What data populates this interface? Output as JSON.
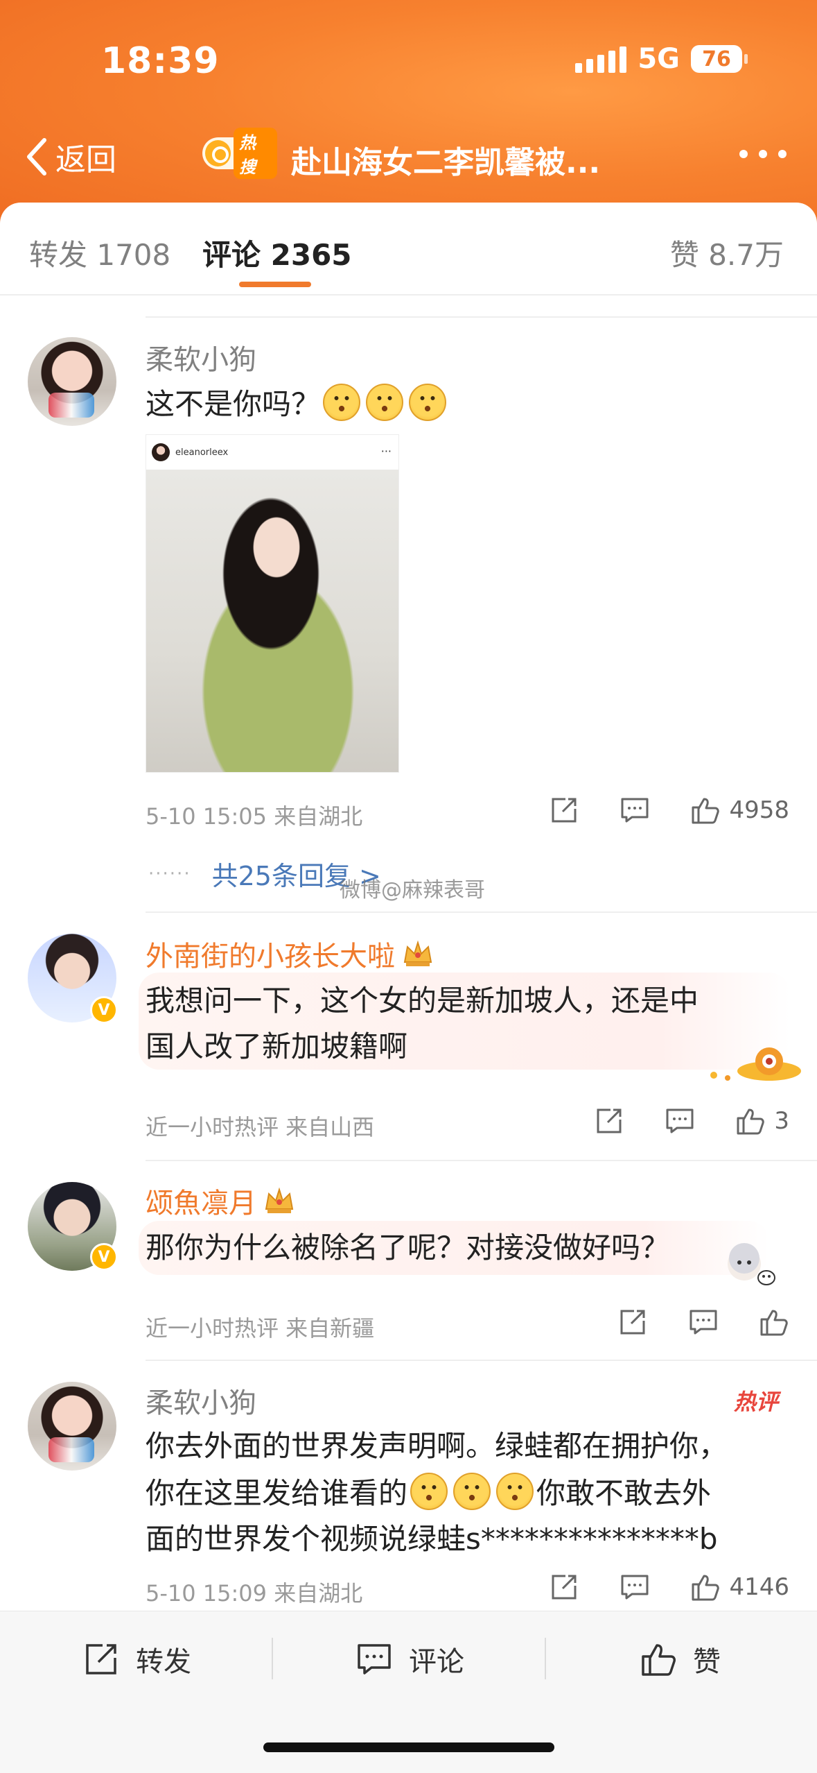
{
  "status": {
    "time": "18:39",
    "network": "5G",
    "battery": "76"
  },
  "nav": {
    "back_label": "返回",
    "hot_badge": "热搜",
    "title": "赴山海女二李凯馨被..."
  },
  "tabs": {
    "repost": "转发 1708",
    "comments": "评论 2365",
    "likes": "赞 8.7万"
  },
  "comments": [
    {
      "user": "柔软小狗",
      "text": "这不是你吗？",
      "photo_caption": "eleanorleex",
      "meta": "5-10 15:05  来自湖北",
      "likes": "4958",
      "replies": "共25条回复 >"
    },
    {
      "user": "外南街的小孩长大啦",
      "text_line1": "我想问一下，这个女的是新加坡人，还是中",
      "text_line2": "国人改了新加坡籍啊",
      "meta": "近一小时热评  来自山西",
      "likes": "3"
    },
    {
      "user": "颂魚凛月",
      "text": "那你为什么被除名了呢？对接没做好吗？",
      "meta": "近一小时热评  来自新疆",
      "likes": ""
    },
    {
      "user": "柔软小狗",
      "hot_tag": "热评",
      "text_line1": "你去外面的世界发声明啊。绿蛙都在拥护你，",
      "text_line2a": "你在这里发给谁看的",
      "text_line2b": "你敢不敢去外",
      "text_line3": "面的世界发个视频说绿蛙s***************b",
      "meta": "5-10 15:09  来自湖北",
      "likes": "4146"
    }
  ],
  "watermark": "微博@麻辣表哥",
  "bottom_bar": {
    "repost": "转发",
    "comment": "评论",
    "like": "赞"
  },
  "colors": {
    "accent": "#f07a2c",
    "link": "#4a79b8",
    "hot": "#e8453c"
  }
}
